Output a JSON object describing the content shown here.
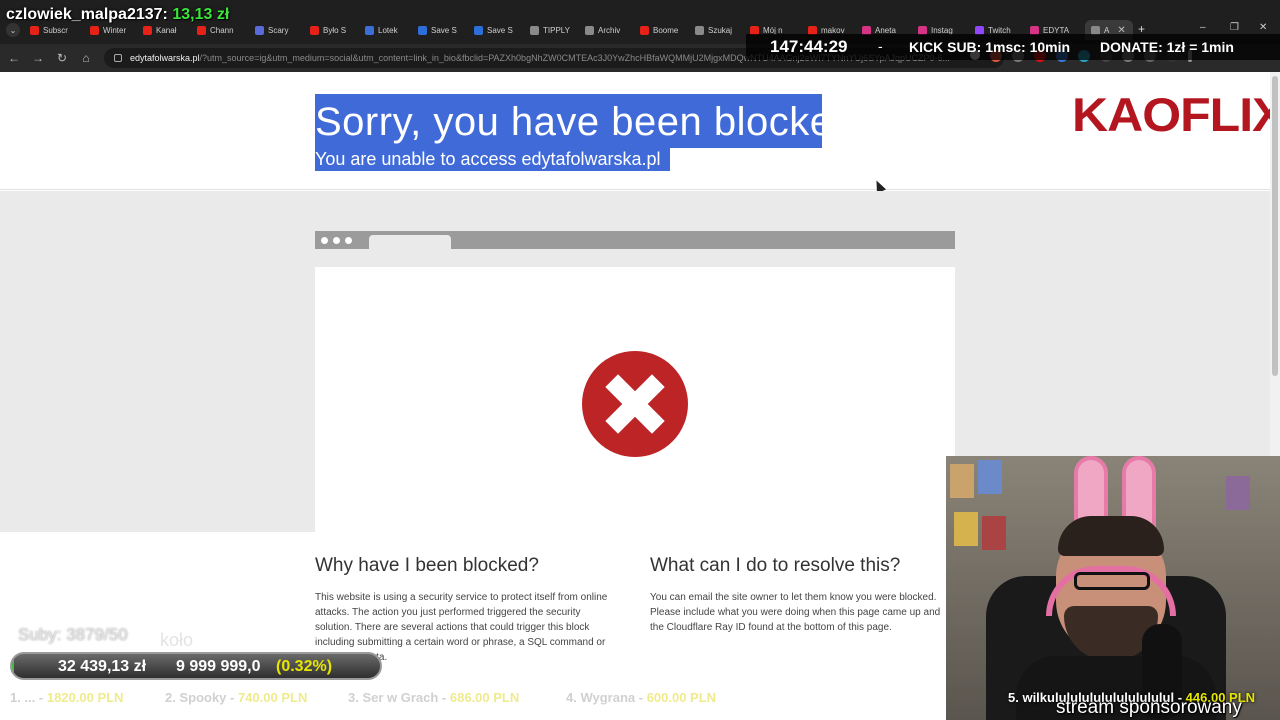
{
  "overlay": {
    "username": "czlowiek_malpa2137:",
    "amount": "13,13 zł",
    "timer": "147:44:29",
    "dash": "-",
    "kick_sub": "KICK SUB: 1msc: 10min",
    "donate": "DONATE: 1zł = 1min",
    "subs": "Suby: 3879/50",
    "kolo": "koło",
    "goal_current": "32 439,13 zł",
    "goal_target": "9 999 999,0",
    "goal_percent": "(0.32%)",
    "goal_fraction": 0.0032,
    "sponsor": "stream sponsorowany"
  },
  "tabs": [
    {
      "label": "Subscr",
      "color": "#e62117"
    },
    {
      "label": "Winter",
      "color": "#e62117"
    },
    {
      "label": "Kanał",
      "color": "#e62117"
    },
    {
      "label": "Chann",
      "color": "#e62117"
    },
    {
      "label": "Scary",
      "color": "#5a6ad8"
    },
    {
      "label": "Było S",
      "color": "#e62117"
    },
    {
      "label": "Lotek",
      "color": "#3b6fd8"
    },
    {
      "label": "Save S",
      "color": "#2d6fd8"
    },
    {
      "label": "Save S",
      "color": "#2d6fd8"
    },
    {
      "label": "TIPPLY",
      "color": "#8a8a8a"
    },
    {
      "label": "Archiv",
      "color": "#8a8a8a"
    },
    {
      "label": "Boome",
      "color": "#e62117"
    },
    {
      "label": "Szukaj",
      "color": "#8a8a8a"
    },
    {
      "label": "Mój n",
      "color": "#e62117"
    },
    {
      "label": "makov",
      "color": "#e62117"
    },
    {
      "label": "Aneta",
      "color": "#d63384"
    },
    {
      "label": "Instag",
      "color": "#d63384"
    },
    {
      "label": "Twitch",
      "color": "#9146ff"
    },
    {
      "label": "EDYTA",
      "color": "#d63384"
    },
    {
      "label": "A",
      "color": "#888888"
    }
  ],
  "browser": {
    "url_domain": "edytafolwarska.pl",
    "url_query": "/?utm_source=ig&utm_medium=social&utm_content=link_in_bio&fbclid=PAZXh0bgNhZW0CMTEAc3J0YwZhcHBfaWQMMjU2MjgxMDQwNTU4AAGnj2eWI7TYNnYUj6SYpAJqpUCZP0-6..."
  },
  "page": {
    "title": "Sorry, you have been blocked",
    "subtitle": "You are unable to access edytafolwarska.pl",
    "logo": "KAOFLIX",
    "why_title": "Why have I been blocked?",
    "why_body": "This website is using a security service to protect itself from online attacks. The action you just performed triggered the security solution. There are several actions that could trigger this block including submitting a certain word or phrase, a SQL command or malformed data.",
    "what_title": "What can I do to resolve this?",
    "what_body": "You can email the site owner to let them know you were blocked. Please include what you were doing when this page came up and the Cloudflare Ray ID found at the bottom of this page."
  },
  "ticker": [
    {
      "label": "1. ... - ",
      "value": "1820.00 PLN"
    },
    {
      "label": "2. Spooky - ",
      "value": "740.00 PLN"
    },
    {
      "label": "3. Ser w Grach - ",
      "value": "686.00 PLN"
    },
    {
      "label": "4. Wygrana - ",
      "value": "600.00 PLN"
    },
    {
      "label": "5. wilkululululululululululul - ",
      "value": "446.00 PLN"
    }
  ]
}
